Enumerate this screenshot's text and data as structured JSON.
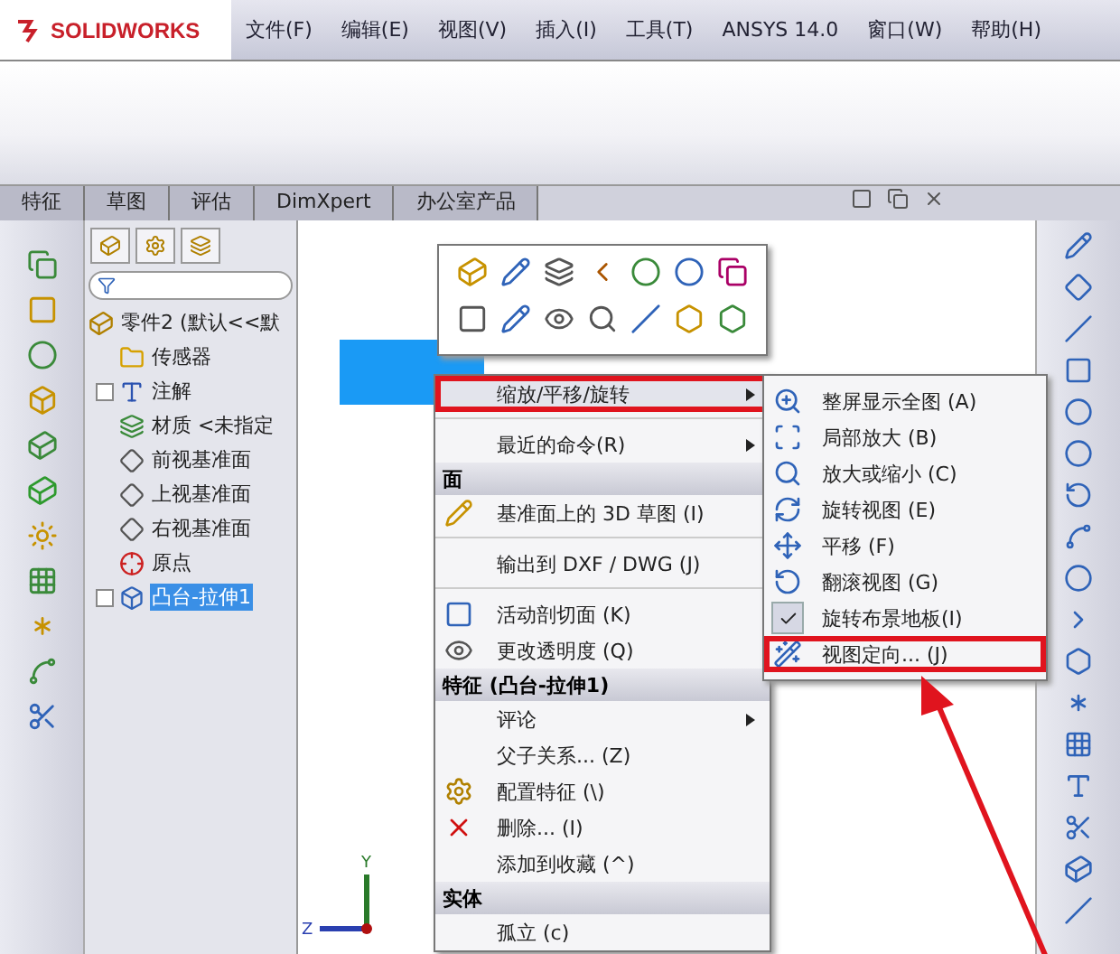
{
  "titlebar": {
    "logo": "SOLIDWORKS",
    "menus": [
      "文件(F)",
      "编辑(E)",
      "视图(V)",
      "插入(I)",
      "工具(T)",
      "ANSYS 14.0",
      "窗口(W)",
      "帮助(H)"
    ]
  },
  "command_tabs": [
    {
      "label": "特征",
      "selected": false
    },
    {
      "label": "草图",
      "selected": false
    },
    {
      "label": "评估",
      "selected": false
    },
    {
      "label": "DimXpert",
      "selected": false
    },
    {
      "label": "办公室产品",
      "selected": false
    }
  ],
  "tree": {
    "root": "零件2 (默认<<默",
    "items": [
      {
        "label": "传感器",
        "expandable": false,
        "selected": false
      },
      {
        "label": "注解",
        "expandable": true,
        "selected": false
      },
      {
        "label": "材质 <未指定",
        "expandable": false,
        "selected": false
      },
      {
        "label": "前视基准面",
        "expandable": false,
        "selected": false
      },
      {
        "label": "上视基准面",
        "expandable": false,
        "selected": false
      },
      {
        "label": "右视基准面",
        "expandable": false,
        "selected": false
      },
      {
        "label": "原点",
        "expandable": false,
        "selected": false
      },
      {
        "label": "凸台-拉伸1",
        "expandable": true,
        "selected": true
      }
    ]
  },
  "triad": {
    "y": "Y",
    "z": "Z"
  },
  "context_menu": {
    "items": [
      {
        "kind": "item",
        "label": "缩放/平移/旋转",
        "submenu": true,
        "selected": true,
        "marked": true
      },
      {
        "kind": "separator"
      },
      {
        "kind": "item",
        "label": "最近的命令(R)",
        "submenu": true,
        "selected": false,
        "marked": false
      },
      {
        "kind": "header",
        "label": "面"
      },
      {
        "kind": "item",
        "label": "基准面上的 3D 草图 (I)",
        "submenu": false,
        "selected": false,
        "marked": false
      },
      {
        "kind": "separator"
      },
      {
        "kind": "item",
        "label": "输出到 DXF / DWG (J)",
        "submenu": false,
        "selected": false,
        "marked": false
      },
      {
        "kind": "separator"
      },
      {
        "kind": "item",
        "label": "活动剖切面 (K)",
        "submenu": false,
        "selected": false,
        "marked": false
      },
      {
        "kind": "item",
        "label": "更改透明度 (Q)",
        "submenu": false,
        "selected": false,
        "marked": false
      },
      {
        "kind": "header",
        "label": "特征 (凸台-拉伸1)"
      },
      {
        "kind": "item",
        "label": "评论",
        "submenu": true,
        "selected": false,
        "marked": false
      },
      {
        "kind": "item",
        "label": "父子关系... (Z)",
        "submenu": false,
        "selected": false,
        "marked": false
      },
      {
        "kind": "item",
        "label": "配置特征 (\\)",
        "submenu": false,
        "selected": false,
        "marked": false
      },
      {
        "kind": "item",
        "label": "删除... (I)",
        "submenu": false,
        "selected": false,
        "marked": false
      },
      {
        "kind": "item",
        "label": "添加到收藏 (^)",
        "submenu": false,
        "selected": false,
        "marked": false
      },
      {
        "kind": "header",
        "label": "实体"
      },
      {
        "kind": "item",
        "label": "孤立 (c)",
        "submenu": false,
        "selected": false,
        "marked": false
      }
    ]
  },
  "submenu": {
    "items": [
      {
        "label": "整屏显示全图 (A)",
        "checked": false,
        "marked": false
      },
      {
        "label": "局部放大 (B)",
        "checked": false,
        "marked": false
      },
      {
        "label": "放大或缩小 (C)",
        "checked": false,
        "marked": false
      },
      {
        "label": "旋转视图 (E)",
        "checked": false,
        "marked": false
      },
      {
        "label": "平移 (F)",
        "checked": false,
        "marked": false
      },
      {
        "label": "翻滚视图 (G)",
        "checked": false,
        "marked": false
      },
      {
        "label": "旋转布景地板(I)",
        "checked": true,
        "marked": false
      },
      {
        "label": "视图定向... (J)",
        "checked": false,
        "marked": true
      }
    ]
  }
}
